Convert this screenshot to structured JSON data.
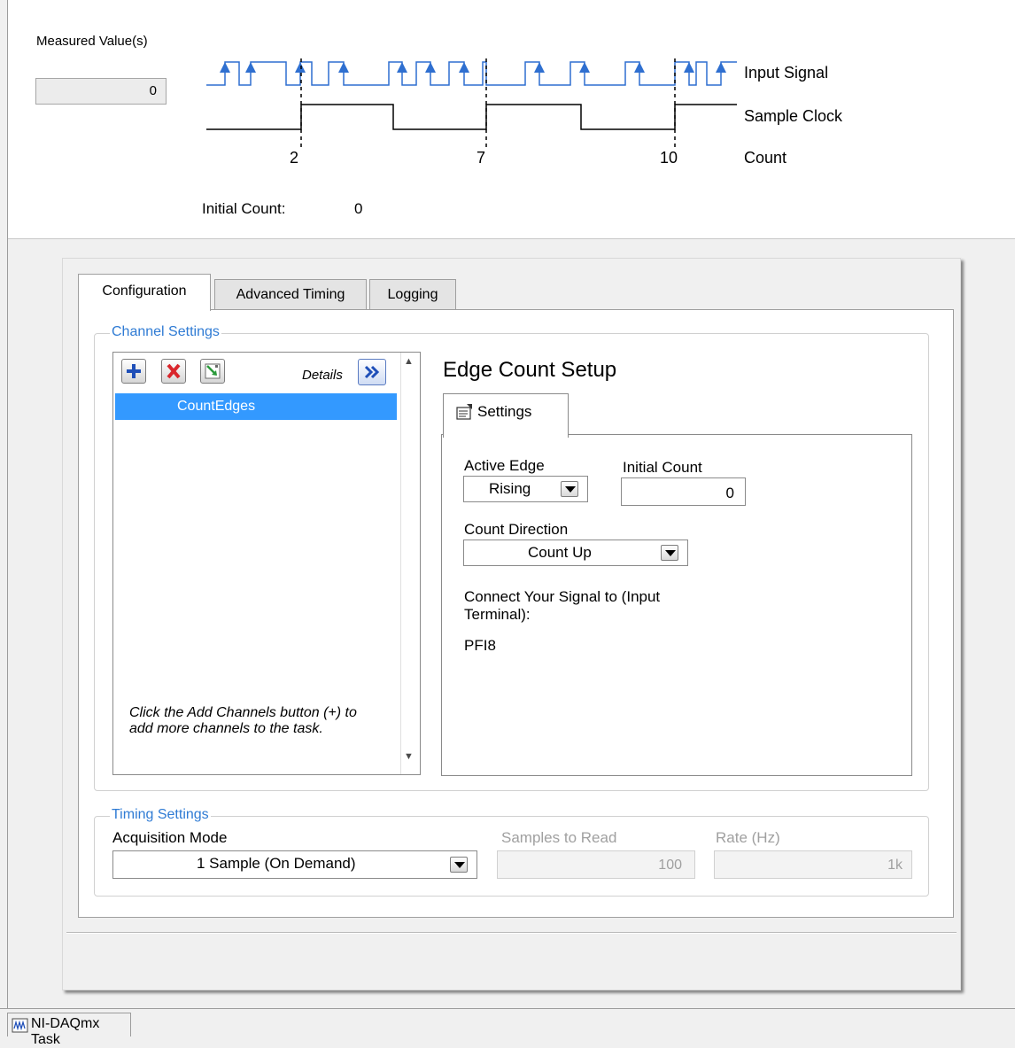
{
  "diagram": {
    "measured_label": "Measured Value(s)",
    "measured_value": "0",
    "signal_labels": {
      "input": "Input Signal",
      "clock": "Sample Clock",
      "count": "Count"
    },
    "count_ticks": [
      "2",
      "7",
      "10"
    ],
    "initial_count_label": "Initial Count:",
    "initial_count_value": "0"
  },
  "tabs": {
    "configuration": "Configuration",
    "advanced_timing": "Advanced Timing",
    "logging": "Logging"
  },
  "channel_settings": {
    "title": "Channel Settings",
    "details_label": "Details",
    "selected_channel": "CountEdges",
    "hint": "Click the Add Channels button (+) to add more channels to the task."
  },
  "setup": {
    "title": "Edge Count Setup",
    "settings_tab": "Settings",
    "active_edge_label": "Active Edge",
    "active_edge_value": "Rising",
    "initial_count_label": "Initial Count",
    "initial_count_value": "0",
    "count_direction_label": "Count Direction",
    "count_direction_value": "Count Up",
    "connect_label": "Connect Your Signal to (Input Terminal):",
    "terminal_value": "PFI8"
  },
  "timing_settings": {
    "title": "Timing Settings",
    "acquisition_mode_label": "Acquisition Mode",
    "acquisition_mode_value": "1 Sample (On Demand)",
    "samples_label": "Samples to Read",
    "samples_value": "100",
    "rate_label": "Rate (Hz)",
    "rate_value": "1k"
  },
  "footer": {
    "task_tab": "NI-DAQmx Task"
  },
  "colors": {
    "signal_blue": "#2f6fd0",
    "selection_blue": "#3399ff",
    "group_title_blue": "#2f7bd4",
    "remove_red": "#d9262c"
  }
}
